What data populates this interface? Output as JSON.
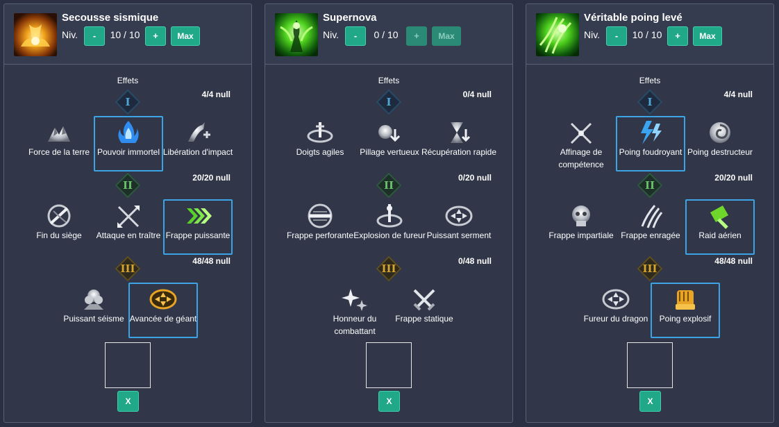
{
  "panels": [
    {
      "title": "Secousse sismique",
      "level_label": "Niv.",
      "level": "10 / 10",
      "minus_label": "-",
      "plus_label": "+",
      "max_label": "Max",
      "effets_label": "Effets",
      "tiers": [
        {
          "numeral": "I",
          "count": "4/4 null"
        },
        {
          "numeral": "II",
          "count": "20/20 null"
        },
        {
          "numeral": "III",
          "count": "48/48 null"
        }
      ],
      "tripods": {
        "t1": [
          "Force de la terre",
          "Pouvoir immortel",
          "Libération d'impact"
        ],
        "t2": [
          "Fin du siège",
          "Attaque en traître",
          "Frappe puissante"
        ],
        "t3": [
          "Puissant séisme",
          "Avancée de géant"
        ]
      },
      "x_label": "X"
    },
    {
      "title": "Supernova",
      "level_label": "Niv.",
      "level": "0 / 10",
      "minus_label": "-",
      "plus_label": "+",
      "max_label": "Max",
      "effets_label": "Effets",
      "tiers": [
        {
          "numeral": "I",
          "count": "0/4 null"
        },
        {
          "numeral": "II",
          "count": "0/20 null"
        },
        {
          "numeral": "III",
          "count": "0/48 null"
        }
      ],
      "tripods": {
        "t1": [
          "Doigts agiles",
          "Pillage vertueux",
          "Récupération rapide"
        ],
        "t2": [
          "Frappe perforante",
          "Explosion de fureur",
          "Puissant serment"
        ],
        "t3": [
          "Honneur du combattant",
          "Frappe statique"
        ]
      },
      "x_label": "X"
    },
    {
      "title": "Véritable poing levé",
      "level_label": "Niv.",
      "level": "10 / 10",
      "minus_label": "-",
      "plus_label": "+",
      "max_label": "Max",
      "effets_label": "Effets",
      "tiers": [
        {
          "numeral": "I",
          "count": "4/4 null"
        },
        {
          "numeral": "II",
          "count": "20/20 null"
        },
        {
          "numeral": "III",
          "count": "48/48 null"
        }
      ],
      "tripods": {
        "t1": [
          "Affinage de compétence",
          "Poing foudroyant",
          "Poing destructeur"
        ],
        "t2": [
          "Frappe impartiale",
          "Frappe enragée",
          "Raid aérien"
        ],
        "t3": [
          "Fureur du dragon",
          "Poing explosif"
        ]
      },
      "x_label": "X"
    }
  ]
}
